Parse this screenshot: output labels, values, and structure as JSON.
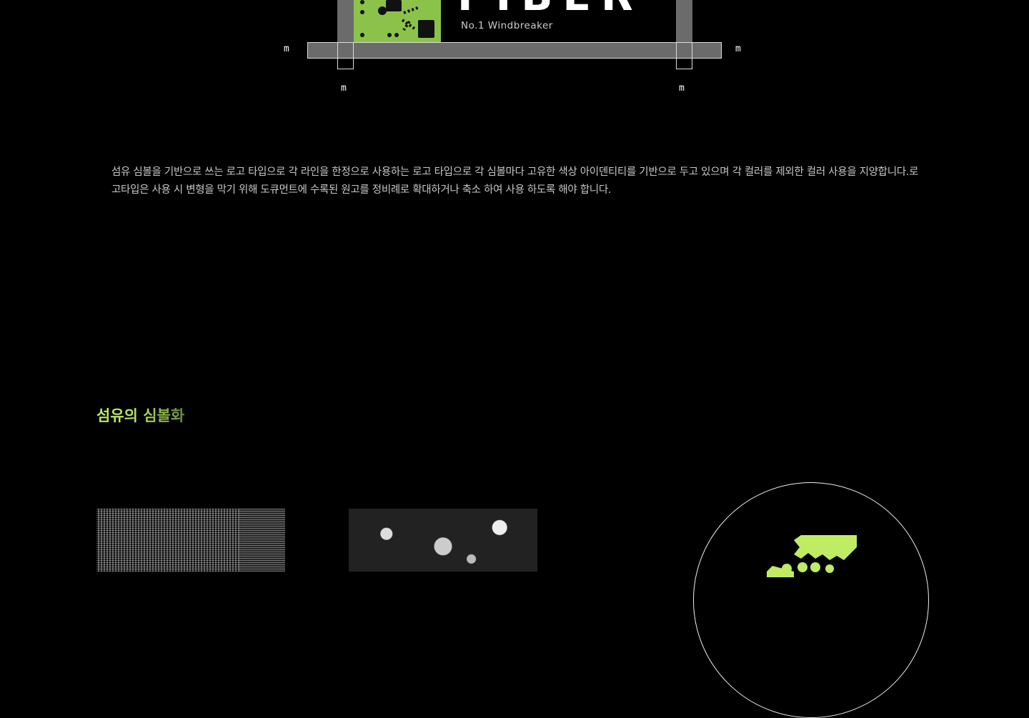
{
  "logo": {
    "tagline": "No.1 Windbreaker",
    "wordmark": "FIBER",
    "accent": "#8bc34a"
  },
  "clearspace": {
    "marker": "m"
  },
  "description": "섬유 심볼을 기반으로 쓰는 로고 타입으로 각 라인을 한정으로 사용하는 로고 타입으로 각 심볼마다 고유한 색상 아이덴티티를 기반으로 두고 있으며 각 컬러를 제외한 컬러 사용을 지양합니다.로고타입은 사용 시 변형을 막기 위해 도큐먼트에 수록된 원고를 정비례로 확대하거나 축소 하여 사용  하도록 해야 합니다.",
  "section": {
    "title": "섬유의 심볼화",
    "accent": "#c0ec64"
  }
}
